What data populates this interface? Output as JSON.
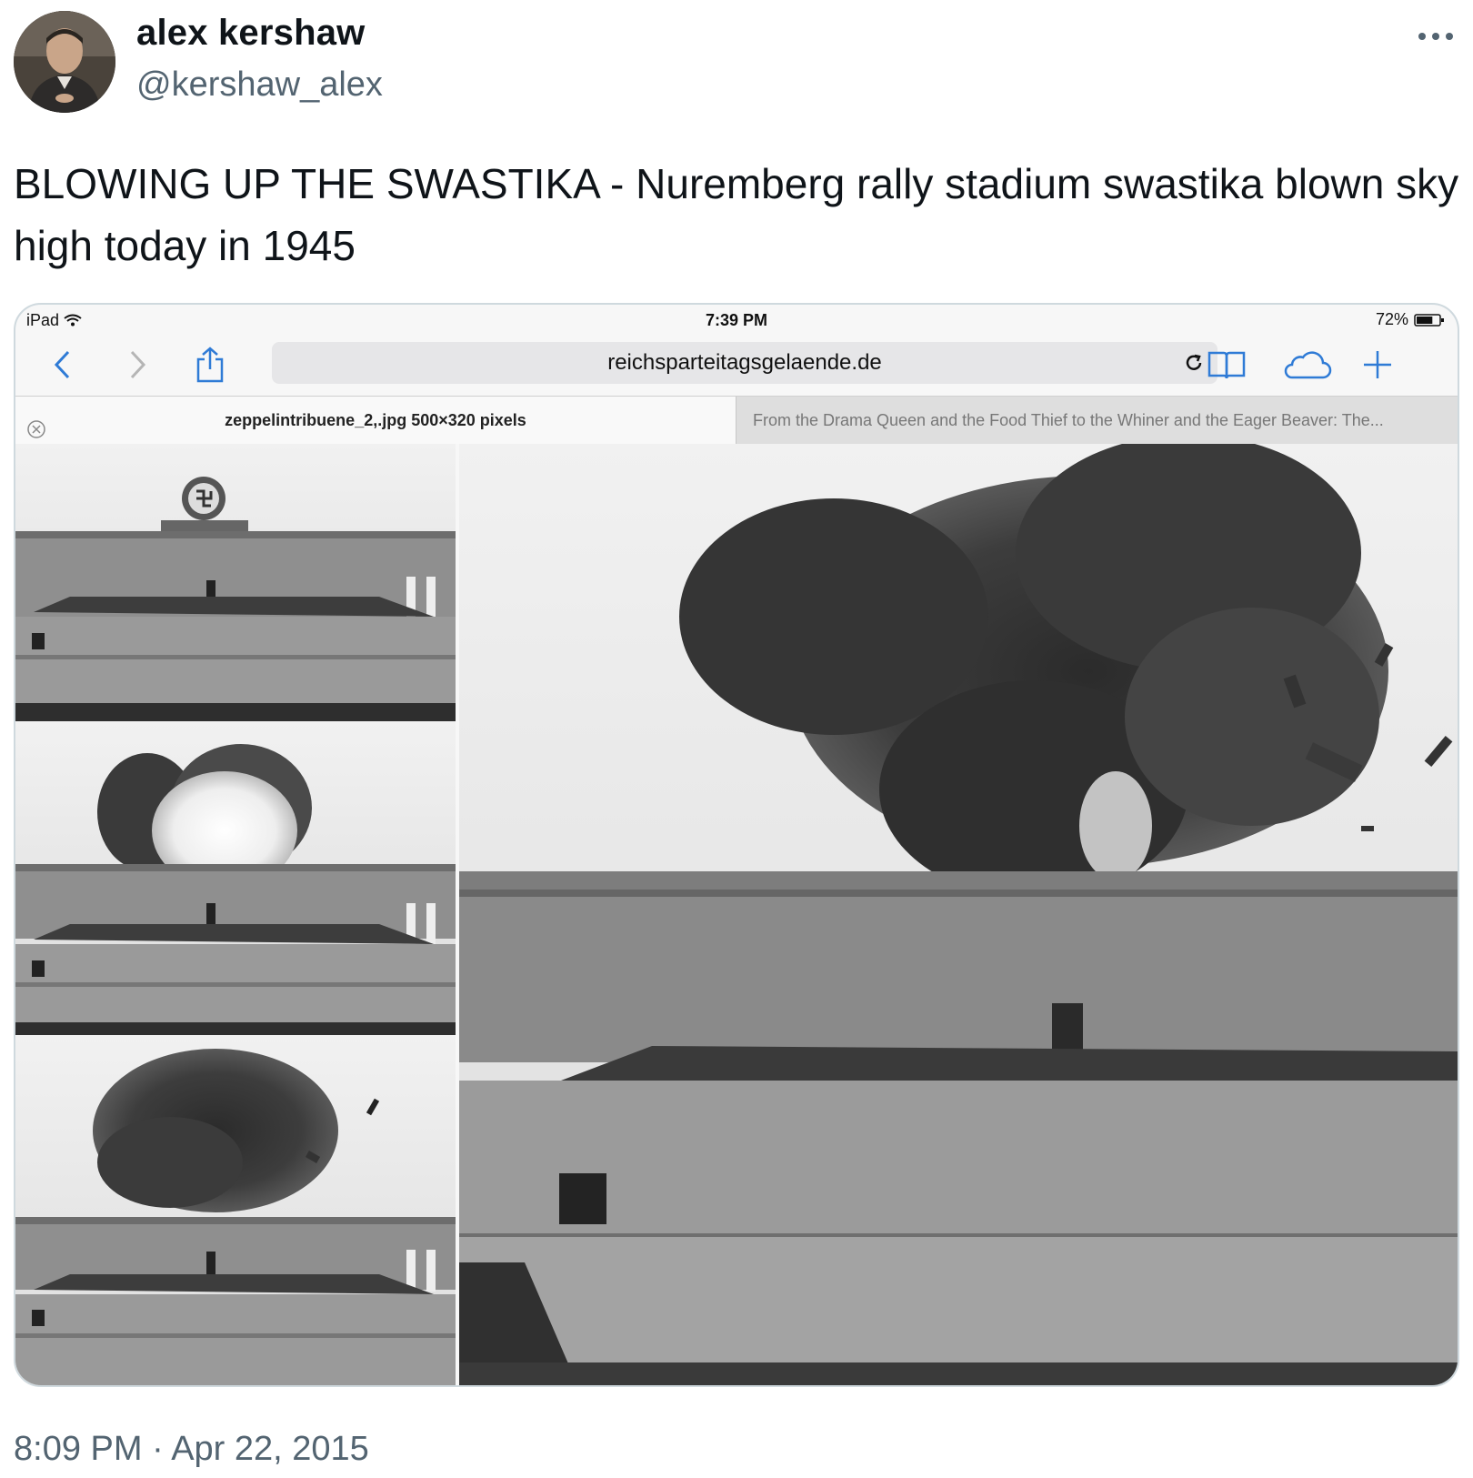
{
  "tweet": {
    "author_name": "alex kershaw",
    "handle": "@kershaw_alex",
    "text": "BLOWING UP THE SWASTIKA - Nuremberg rally stadium swastika blown sky high today in 1945",
    "timestamp": "8:09 PM · Apr 22, 2015"
  },
  "screenshot": {
    "device": "iPad",
    "time": "7:39 PM",
    "battery": "72%",
    "url": "reichsparteitagsgelaende.de",
    "active_tab": "zeppelintribuene_2,.jpg 500×320 pixels",
    "inactive_tab": "From the Drama Queen and the Food Thief to the Whiner and the Eager Beaver: The...",
    "battery_level": 0.72
  },
  "icons": {
    "more": "more-icon",
    "back": "back-chevron-icon",
    "forward": "forward-chevron-icon",
    "share": "share-icon",
    "reload": "reload-icon",
    "bookmarks": "book-icon",
    "cloud": "cloud-tabs-icon",
    "new_tab": "plus-icon",
    "close_tab": "close-tab-icon",
    "wifi": "wifi-icon",
    "battery": "battery-icon"
  },
  "colors": {
    "ios_blue": "#2f7bd6",
    "secondary_text": "#536471"
  }
}
